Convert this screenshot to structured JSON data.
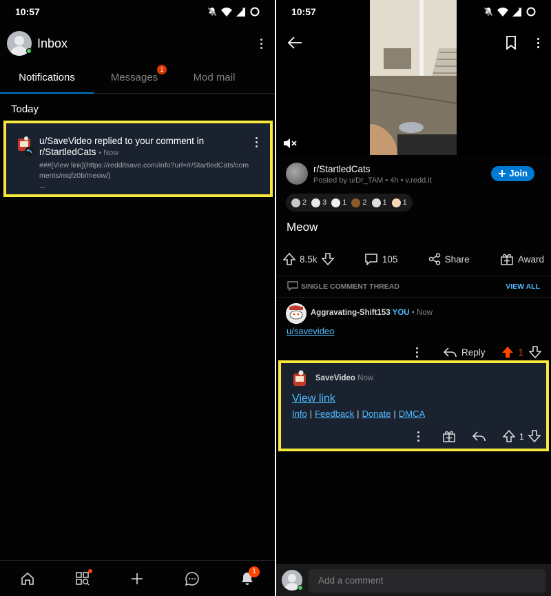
{
  "left": {
    "status": {
      "time": "10:57"
    },
    "header": {
      "title": "Inbox"
    },
    "tabs": [
      {
        "label": "Notifications"
      },
      {
        "label": "Messages",
        "badge": "1"
      },
      {
        "label": "Mod mail"
      }
    ],
    "section": "Today",
    "notification": {
      "text": "u/SaveVideo replied to your comment in r/StartledCats",
      "time": "• Now",
      "body": "###[View link](https://redditsave.com/info?url=/r/StartledCats/comments/mqfz0b/meow/)",
      "ellipsis": "..."
    },
    "bottom_nav": {
      "inbox_badge": "1"
    }
  },
  "right": {
    "status": {
      "time": "10:57"
    },
    "post": {
      "subreddit": "r/StartledCats",
      "meta": "Posted by u/Dr_TAM • 4h • v.redd.it",
      "join_label": "Join",
      "awards": [
        {
          "icon": "award-1-icon",
          "count": "2",
          "color": "#c9c9c9"
        },
        {
          "icon": "award-2-icon",
          "count": "3",
          "color": "#e8e8e8"
        },
        {
          "icon": "award-3-icon",
          "count": "1",
          "color": "#f0f0f0"
        },
        {
          "icon": "award-4-icon",
          "count": "2",
          "color": "#8a5a2a"
        },
        {
          "icon": "award-5-icon",
          "count": "1",
          "color": "#dddddd"
        },
        {
          "icon": "award-6-icon",
          "count": "1",
          "color": "#f5d6b4"
        }
      ],
      "title": "Meow",
      "votes": "8.5k",
      "comments": "105",
      "share_label": "Share",
      "award_label": "Award"
    },
    "thread": {
      "label": "SINGLE COMMENT THREAD",
      "view_all": "VIEW ALL"
    },
    "comment1": {
      "user": "Aggravating-Shift153",
      "you": "YOU",
      "time": "• Now",
      "link": "u/savevideo",
      "reply_label": "Reply",
      "votes": "1"
    },
    "reply": {
      "user": "SaveVideo",
      "time": "Now",
      "view_link": "View link",
      "links": [
        "Info",
        "Feedback",
        "Donate",
        "DMCA"
      ],
      "separator": "|",
      "votes": "1"
    },
    "comment_bar": {
      "placeholder": "Add a comment"
    }
  }
}
